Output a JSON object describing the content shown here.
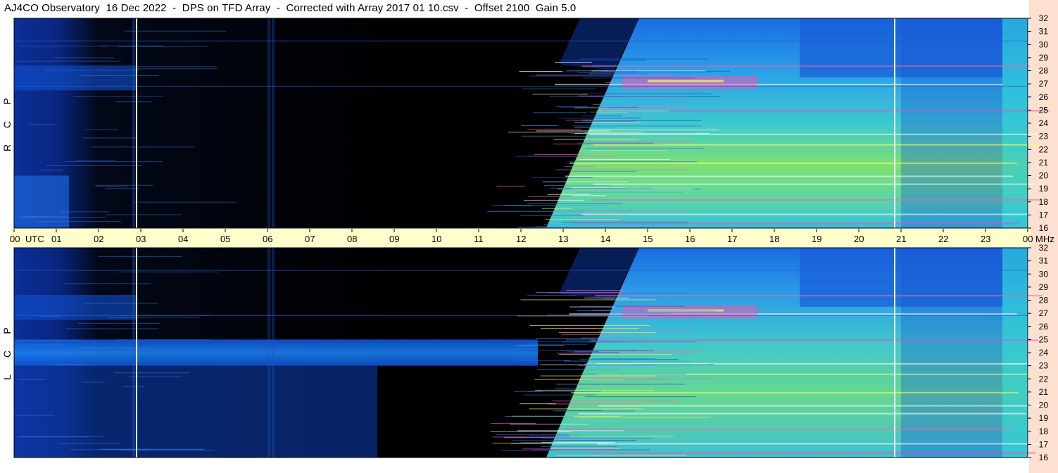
{
  "header": {
    "title": "AJ4CO Observatory  16 Dec 2022  -  DPS on TFD Array  -  Corrected with Array 2017 01 10.csv  -  Offset 2100  Gain 5.0"
  },
  "colors": {
    "background_dark": "#000000",
    "deep_blue": "#0a2a8a",
    "blue": "#1560d8",
    "light_blue": "#2aa0e8",
    "cyan": "#36d0c8",
    "green": "#7ee870",
    "yellow": "#f0f040",
    "magenta": "#e040a0",
    "time_strip": "#ffffcc",
    "right_strip": "#fde0cf"
  },
  "chart_data": [
    {
      "type": "heatmap",
      "panel": "top",
      "polarization_label": [
        "R",
        "C",
        "P"
      ],
      "x_label": "UTC",
      "x_ticks": [
        "00",
        "01",
        "02",
        "03",
        "04",
        "05",
        "06",
        "07",
        "08",
        "09",
        "10",
        "11",
        "12",
        "13",
        "14",
        "15",
        "16",
        "17",
        "18",
        "19",
        "20",
        "21",
        "22",
        "23",
        "00"
      ],
      "x_range_hours": [
        0,
        24
      ],
      "y_label": "MHz",
      "y_ticks": [
        16,
        17,
        18,
        19,
        20,
        21,
        22,
        23,
        24,
        25,
        26,
        27,
        28,
        29,
        30,
        31,
        32
      ],
      "y_range_mhz": [
        16,
        32
      ],
      "activity": [
        {
          "name": "night-ramp-start",
          "utc": 12.4,
          "low_mhz": 16
        },
        {
          "name": "ramp-top",
          "utc": 14.6,
          "high_mhz": 32
        },
        {
          "name": "night-end-left",
          "utc": 3.0
        }
      ],
      "markers_utc": [
        2.9,
        20.85
      ]
    },
    {
      "type": "heatmap",
      "panel": "bottom",
      "polarization_label": [
        "L",
        "C",
        "P"
      ],
      "x_label": "UTC",
      "x_ticks": [
        "00",
        "01",
        "02",
        "03",
        "04",
        "05",
        "06",
        "07",
        "08",
        "09",
        "10",
        "11",
        "12",
        "13",
        "14",
        "15",
        "16",
        "17",
        "18",
        "19",
        "20",
        "21",
        "22",
        "23",
        "00"
      ],
      "x_range_hours": [
        0,
        24
      ],
      "y_label": "MHz",
      "y_ticks": [
        16,
        17,
        18,
        19,
        20,
        21,
        22,
        23,
        24,
        25,
        26,
        27,
        28,
        29,
        30,
        31,
        32
      ],
      "y_range_mhz": [
        16,
        32
      ],
      "markers_utc": [
        2.9,
        20.85
      ]
    }
  ],
  "labels": {
    "utc": "UTC",
    "mhz": "MHz",
    "top_pol": [
      "R",
      "C",
      "P"
    ],
    "bottom_pol": [
      "L",
      "C",
      "P"
    ]
  }
}
